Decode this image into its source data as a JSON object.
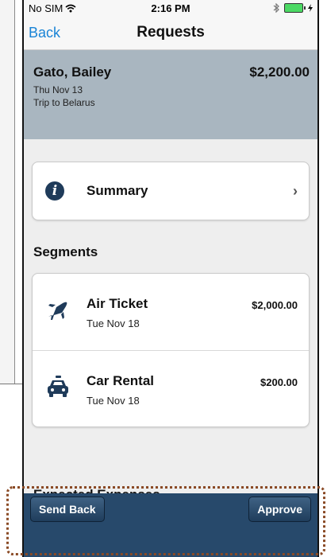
{
  "status_bar": {
    "carrier": "No SIM",
    "time": "2:16 PM",
    "bluetooth_icon": "bluetooth-icon",
    "battery_color": "#4cd964"
  },
  "nav": {
    "back_label": "Back",
    "title": "Requests"
  },
  "request": {
    "name": "Gato, Bailey",
    "amount": "$2,200.00",
    "date": "Thu Nov 13",
    "trip": "Trip to Belarus",
    "header_color": "#a9b6c0"
  },
  "summary": {
    "label": "Summary",
    "icon": "info-icon"
  },
  "segments": {
    "title": "Segments",
    "items": [
      {
        "title": "Air Ticket",
        "date": "Tue Nov 18",
        "amount": "$2,000.00",
        "icon": "airplane-icon"
      },
      {
        "title": "Car Rental",
        "date": "Tue Nov 18",
        "amount": "$200.00",
        "icon": "car-icon"
      }
    ]
  },
  "expected_expenses": {
    "title": "Expected Expenses"
  },
  "toolbar": {
    "send_back_label": "Send Back",
    "approve_label": "Approve",
    "color": "#27496b"
  },
  "accent_color": "#1a84d6"
}
